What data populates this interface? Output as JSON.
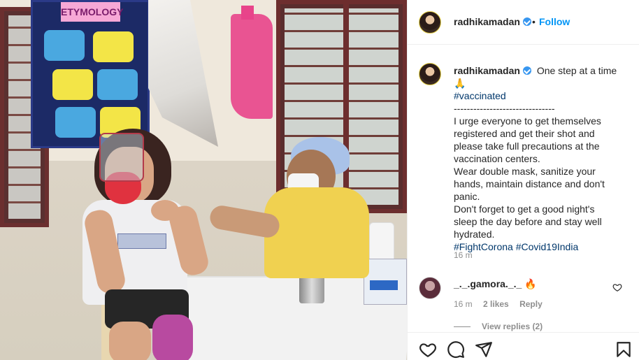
{
  "post": {
    "author": "radhikamadan",
    "follow_label": "Follow",
    "dot": "•",
    "caption": {
      "author": "radhikamadan",
      "title": "One step at a time 🙏",
      "hashtag_top": "#vaccinated",
      "separator": "-------------------------------",
      "lines": [
        "I urge everyone to get themselves",
        "registered and get their shot and",
        "please take full precautions at the",
        "vaccination centers.",
        "Wear double mask, sanitize your",
        "hands, maintain distance and don't",
        "panic.",
        "Don't forget to get a good night's",
        "sleep the day before and stay well",
        "hydrated."
      ],
      "hashtags_bottom": "#FightCorona #Covid19India",
      "time": "16 m"
    },
    "comment": {
      "user": "_._.gamora._._",
      "text": "🔥",
      "time": "16 m",
      "likes": "2 likes",
      "reply_label": "Reply",
      "view_replies": "View replies (2)"
    },
    "photo": {
      "board_heading": "ETYMOLOGY"
    }
  },
  "icons": {
    "like": "heart-icon",
    "comment": "comment-icon",
    "share": "share-icon",
    "save": "bookmark-icon",
    "verified": "verified-badge-icon"
  },
  "colors": {
    "link_blue": "#0095f6",
    "hashtag": "#00376b",
    "verified": "#3897f0",
    "muted": "#8e8e8e"
  }
}
